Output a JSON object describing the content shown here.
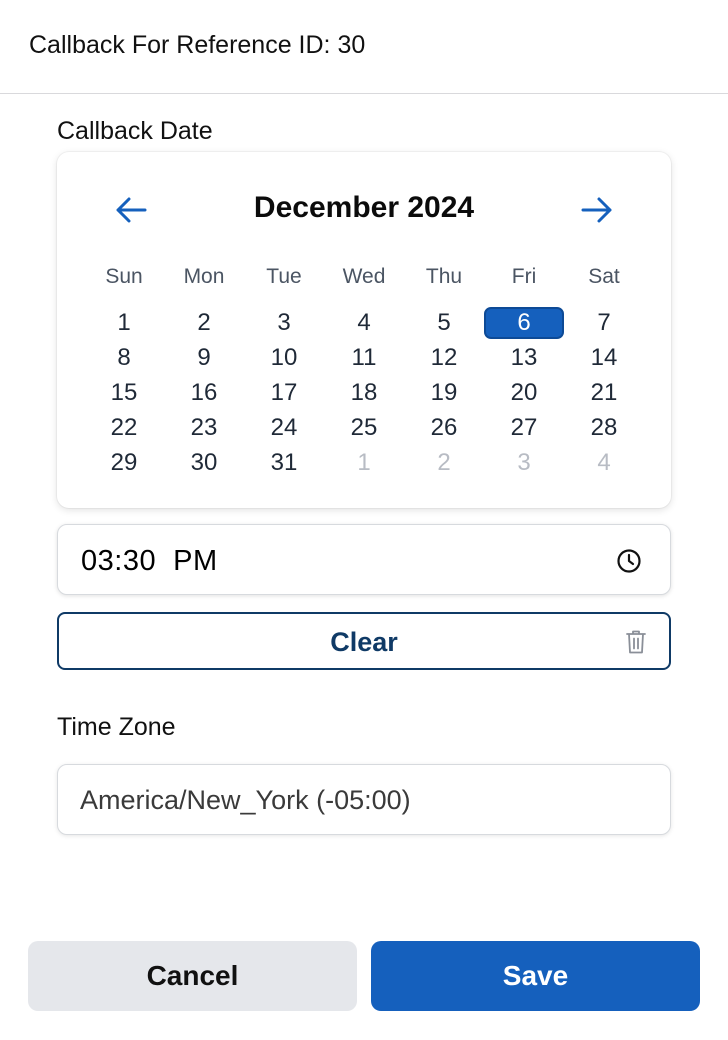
{
  "header": {
    "title": "Callback For Reference ID: 30"
  },
  "callback_date": {
    "label": "Callback Date",
    "calendar": {
      "month_title": "December 2024",
      "prev_icon": "arrow-left-icon",
      "next_icon": "arrow-right-icon",
      "weekdays": [
        "Sun",
        "Mon",
        "Tue",
        "Wed",
        "Thu",
        "Fri",
        "Sat"
      ],
      "weeks": [
        [
          "1",
          "2",
          "3",
          "4",
          "5",
          "6",
          "7"
        ],
        [
          "8",
          "9",
          "10",
          "11",
          "12",
          "13",
          "14"
        ],
        [
          "15",
          "16",
          "17",
          "18",
          "19",
          "20",
          "21"
        ],
        [
          "22",
          "23",
          "24",
          "25",
          "26",
          "27",
          "28"
        ],
        [
          "29",
          "30",
          "31",
          "1",
          "2",
          "3",
          "4"
        ]
      ],
      "selected_day": "6",
      "accent_color": "#1560bd"
    }
  },
  "time": {
    "value": "03:30  PM",
    "icon": "clock-icon"
  },
  "clear_button": {
    "label": "Clear",
    "icon": "trash-icon"
  },
  "time_zone": {
    "label": "Time Zone",
    "value": "America/New_York (-05:00)"
  },
  "footer": {
    "cancel_label": "Cancel",
    "save_label": "Save"
  }
}
